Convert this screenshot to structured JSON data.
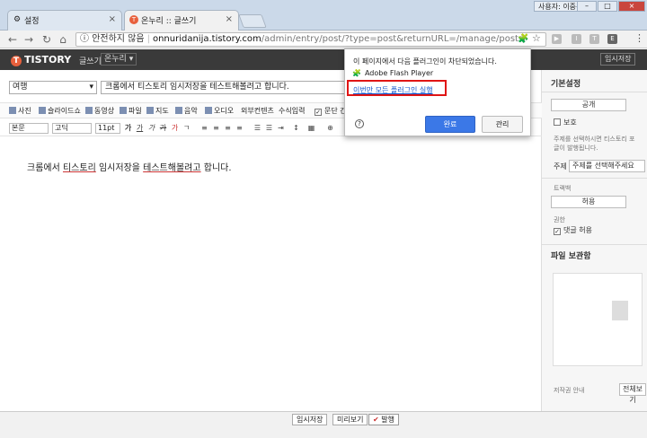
{
  "window": {
    "profile_label": "사용자: 이중원",
    "tabs": [
      {
        "icon": "gear-icon",
        "label": "설정"
      },
      {
        "icon": "tistory-icon",
        "label": "온누리 :: 글쓰기"
      }
    ]
  },
  "toolbar": {
    "security_label": "안전하지 않음",
    "url_host": "onnuridanija.tistory.com",
    "url_path": "/admin/entry/post/?type=post&returnURL=/manage/posts/"
  },
  "tistory": {
    "logo": "TISTORY",
    "logo_badge": "T",
    "section": "글쓰기",
    "blog_select": "온누리",
    "temp_save_top": "임시저장"
  },
  "editor": {
    "category": "여행",
    "title": "크롬에서 티스토리 임시저장을 테스트해볼려고 합니다.",
    "attach_items": [
      "사진",
      "슬라이드쇼",
      "동영상",
      "파일",
      "지도",
      "음악",
      "오디오",
      "외부컨텐츠",
      "수식입력",
      "문단 간격"
    ],
    "style_select": "본문",
    "font_select": "고딕",
    "size_select": "11pt",
    "content_pre": "크롬에서 ",
    "content_word1": "티스토리",
    "content_mid": " 임시저장을 ",
    "content_word2": "테스트해볼려고",
    "content_post": " 합니다."
  },
  "panel": {
    "title": "기본설정",
    "visibility_public": "공개",
    "protect_label": "보호",
    "protect_desc1": "주제를 선택하시면 티스토리 포",
    "protect_desc2": "글이 발행됩니다.",
    "topic_label": "주제",
    "topic_select": "주제를 선택해주세요",
    "trackback_label": "트랙백",
    "trackback_value": "허용",
    "comment_label": "권한",
    "comment_allow": "댓글 허용",
    "file_box_label": "파일 보관함",
    "license_label": "저작권 안내",
    "license_value": "전체보기"
  },
  "bottom": {
    "temp_save": "임시저장",
    "preview": "미리보기",
    "publish": "발행"
  },
  "popup": {
    "message": "이 페이지에서 다음 플러그인이 차단되었습니다.",
    "plugin_name": "Adobe Flash Player",
    "run_all_link": "이번만 모든 플러그인 실행",
    "done_label": "완료",
    "manage_label": "관리",
    "highlight_color": "#e01515"
  }
}
